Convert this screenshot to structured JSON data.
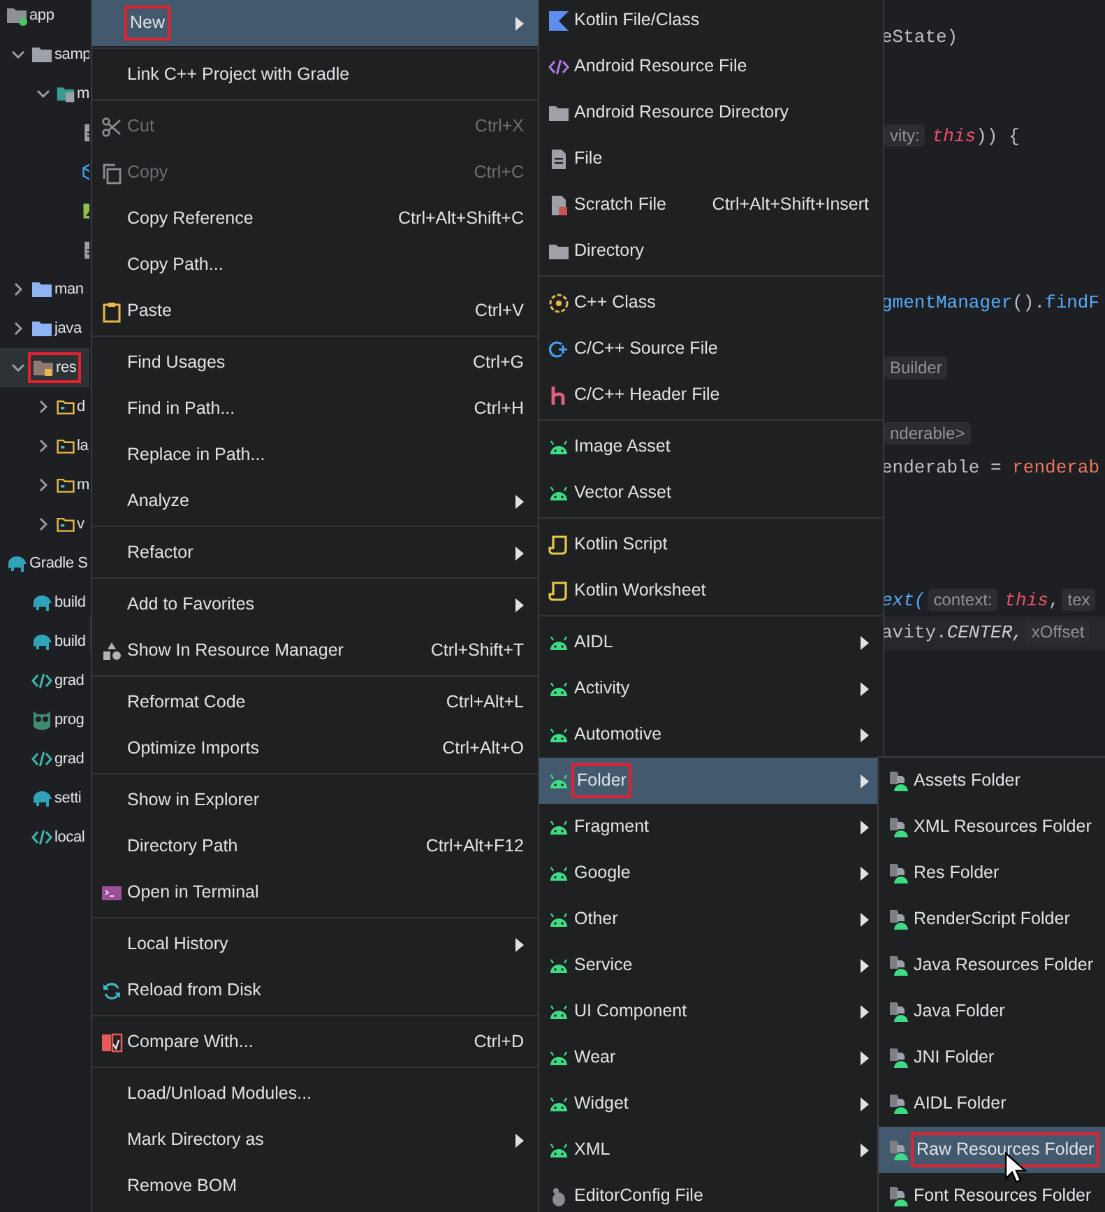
{
  "project_tree": [
    {
      "label": "app",
      "kind": "module",
      "selected": false,
      "annotated": false,
      "children": [
        {
          "label": "samp",
          "kind": "folder",
          "expanded": true,
          "selected": false,
          "annotated": false,
          "children": [
            {
              "label": "m",
              "kind": "source-set",
              "expanded": true,
              "selected": false,
              "annotated": false,
              "children": [
                {
                  "kind": "document",
                  "selected": false,
                  "annotated": false
                },
                {
                  "kind": "cube",
                  "selected": false,
                  "annotated": false
                },
                {
                  "kind": "image",
                  "selected": false,
                  "annotated": false
                },
                {
                  "kind": "document",
                  "selected": false,
                  "annotated": false
                }
              ]
            }
          ]
        },
        {
          "label": "man",
          "kind": "blue-folder",
          "expanded": false,
          "selected": false,
          "annotated": false
        },
        {
          "label": "java",
          "kind": "blue-folder",
          "expanded": false,
          "selected": false,
          "annotated": false
        },
        {
          "label": "res",
          "kind": "res-folder",
          "expanded": true,
          "selected": true,
          "annotated": true,
          "children": [
            {
              "label": "d",
              "kind": "res-dir",
              "expanded": false,
              "selected": false,
              "annotated": false
            },
            {
              "label": "la",
              "kind": "res-dir",
              "expanded": false,
              "selected": false,
              "annotated": false
            },
            {
              "label": "m",
              "kind": "res-dir",
              "expanded": false,
              "selected": false,
              "annotated": false
            },
            {
              "label": "v",
              "kind": "res-dir",
              "expanded": false,
              "selected": false,
              "annotated": false
            }
          ]
        }
      ]
    },
    {
      "label": "Gradle S",
      "kind": "gradle",
      "selected": false,
      "annotated": false,
      "children": [
        {
          "label": "build",
          "kind": "gradle",
          "selected": false,
          "annotated": false
        },
        {
          "label": "build",
          "kind": "gradle",
          "selected": false,
          "annotated": false
        },
        {
          "label": "grad",
          "kind": "xml",
          "selected": false,
          "annotated": false
        },
        {
          "label": "prog",
          "kind": "owl",
          "selected": false,
          "annotated": false
        },
        {
          "label": "grad",
          "kind": "xml",
          "selected": false,
          "annotated": false
        },
        {
          "label": "setti",
          "kind": "gradle",
          "selected": false,
          "annotated": false
        },
        {
          "label": "local",
          "kind": "xml",
          "selected": false,
          "annotated": false
        }
      ]
    }
  ],
  "editor": {
    "lines": [
      {
        "kind": "code",
        "current": false,
        "segments": [
          {
            "text": "eState)",
            "kind": "plain"
          }
        ]
      },
      {
        "kind": "blank"
      },
      {
        "kind": "blank"
      },
      {
        "kind": "code",
        "current": false,
        "segments": [
          {
            "text": "vity:",
            "kind": "hint"
          },
          {
            "text": "this",
            "kind": "keyword"
          },
          {
            "text": ")) {",
            "kind": "plain"
          }
        ]
      },
      {
        "kind": "blank"
      },
      {
        "kind": "blank"
      },
      {
        "kind": "blank"
      },
      {
        "kind": "blank"
      },
      {
        "kind": "code",
        "current": false,
        "segments": [
          {
            "text": "gmentManager",
            "kind": "method"
          },
          {
            "text": "().",
            "kind": "plain"
          },
          {
            "text": "findF",
            "kind": "method"
          }
        ]
      },
      {
        "kind": "blank"
      },
      {
        "kind": "code",
        "current": false,
        "segments": [
          {
            "text": "Builder",
            "kind": "hint"
          }
        ]
      },
      {
        "kind": "blank"
      },
      {
        "kind": "code",
        "current": false,
        "segments": [
          {
            "text": "nderable>",
            "kind": "hint"
          }
        ]
      },
      {
        "kind": "code",
        "current": false,
        "segments": [
          {
            "text": "enderable = ",
            "kind": "plain"
          },
          {
            "text": "renderab",
            "kind": "field"
          }
        ]
      },
      {
        "kind": "blank"
      },
      {
        "kind": "blank"
      },
      {
        "kind": "blank"
      },
      {
        "kind": "code",
        "current": false,
        "segments": [
          {
            "text": "ext(",
            "kind": "call"
          },
          {
            "text": "context:",
            "kind": "hint"
          },
          {
            "text": "this",
            "kind": "keyword"
          },
          {
            "text": ",",
            "kind": "plain"
          },
          {
            "text": "tex",
            "kind": "hint"
          }
        ]
      },
      {
        "kind": "code",
        "current": true,
        "segments": [
          {
            "text": "avity.",
            "kind": "plain"
          },
          {
            "text": "CENTER,",
            "kind": "constant"
          },
          {
            "text": "xOffset",
            "kind": "hint"
          }
        ]
      }
    ]
  },
  "context_menu": [
    {
      "kind": "plain",
      "label": "New",
      "submenu": true,
      "disabled": false,
      "selected": true,
      "annotated": true
    },
    {
      "kind": "separator"
    },
    {
      "kind": "plain",
      "label": "Link C++ Project with Gradle",
      "submenu": false,
      "disabled": false,
      "selected": false,
      "annotated": false
    },
    {
      "kind": "separator"
    },
    {
      "kind": "scissors",
      "label": "Cut",
      "shortcut": "Ctrl+X",
      "submenu": false,
      "disabled": true,
      "selected": false,
      "annotated": false
    },
    {
      "kind": "copy",
      "label": "Copy",
      "shortcut": "Ctrl+C",
      "submenu": false,
      "disabled": true,
      "selected": false,
      "annotated": false
    },
    {
      "kind": "plain",
      "label": "Copy Reference",
      "shortcut": "Ctrl+Alt+Shift+C",
      "submenu": false,
      "disabled": false,
      "selected": false,
      "annotated": false
    },
    {
      "kind": "plain",
      "label": "Copy Path...",
      "submenu": false,
      "disabled": false,
      "selected": false,
      "annotated": false
    },
    {
      "kind": "clipboard",
      "label": "Paste",
      "shortcut": "Ctrl+V",
      "submenu": false,
      "disabled": false,
      "selected": false,
      "annotated": false
    },
    {
      "kind": "separator"
    },
    {
      "kind": "plain",
      "label": "Find Usages",
      "shortcut": "Ctrl+G",
      "submenu": false,
      "disabled": false,
      "selected": false,
      "annotated": false
    },
    {
      "kind": "plain",
      "label": "Find in Path...",
      "shortcut": "Ctrl+H",
      "submenu": false,
      "disabled": false,
      "selected": false,
      "annotated": false
    },
    {
      "kind": "plain",
      "label": "Replace in Path...",
      "submenu": false,
      "disabled": false,
      "selected": false,
      "annotated": false
    },
    {
      "kind": "plain",
      "label": "Analyze",
      "submenu": true,
      "disabled": false,
      "selected": false,
      "annotated": false
    },
    {
      "kind": "separator"
    },
    {
      "kind": "plain",
      "label": "Refactor",
      "submenu": true,
      "disabled": false,
      "selected": false,
      "annotated": false
    },
    {
      "kind": "separator"
    },
    {
      "kind": "plain",
      "label": "Add to Favorites",
      "submenu": true,
      "disabled": false,
      "selected": false,
      "annotated": false
    },
    {
      "kind": "shapes",
      "label": "Show In Resource Manager",
      "shortcut": "Ctrl+Shift+T",
      "submenu": false,
      "disabled": false,
      "selected": false,
      "annotated": false
    },
    {
      "kind": "separator"
    },
    {
      "kind": "plain",
      "label": "Reformat Code",
      "shortcut": "Ctrl+Alt+L",
      "submenu": false,
      "disabled": false,
      "selected": false,
      "annotated": false
    },
    {
      "kind": "plain",
      "label": "Optimize Imports",
      "shortcut": "Ctrl+Alt+O",
      "submenu": false,
      "disabled": false,
      "selected": false,
      "annotated": false
    },
    {
      "kind": "separator"
    },
    {
      "kind": "plain",
      "label": "Show in Explorer",
      "submenu": false,
      "disabled": false,
      "selected": false,
      "annotated": false
    },
    {
      "kind": "plain",
      "label": "Directory Path",
      "shortcut": "Ctrl+Alt+F12",
      "submenu": false,
      "disabled": false,
      "selected": false,
      "annotated": false
    },
    {
      "kind": "terminal",
      "label": "Open in Terminal",
      "submenu": false,
      "disabled": false,
      "selected": false,
      "annotated": false
    },
    {
      "kind": "separator"
    },
    {
      "kind": "plain",
      "label": "Local History",
      "submenu": true,
      "disabled": false,
      "selected": false,
      "annotated": false
    },
    {
      "kind": "refresh",
      "label": "Reload from Disk",
      "submenu": false,
      "disabled": false,
      "selected": false,
      "annotated": false
    },
    {
      "kind": "separator"
    },
    {
      "kind": "compare",
      "label": "Compare With...",
      "shortcut": "Ctrl+D",
      "submenu": false,
      "disabled": false,
      "selected": false,
      "annotated": false
    },
    {
      "kind": "separator"
    },
    {
      "kind": "plain",
      "label": "Load/Unload Modules...",
      "submenu": false,
      "disabled": false,
      "selected": false,
      "annotated": false
    },
    {
      "kind": "plain",
      "label": "Mark Directory as",
      "submenu": true,
      "disabled": false,
      "selected": false,
      "annotated": false
    },
    {
      "kind": "plain",
      "label": "Remove BOM",
      "submenu": false,
      "disabled": false,
      "selected": false,
      "annotated": false
    }
  ],
  "new_submenu": [
    {
      "kind": "kotlin",
      "label": "Kotlin File/Class",
      "submenu": false,
      "selected": false,
      "annotated": false
    },
    {
      "kind": "code",
      "label": "Android Resource File",
      "submenu": false,
      "selected": false,
      "annotated": false
    },
    {
      "kind": "folder",
      "label": "Android Resource Directory",
      "submenu": false,
      "selected": false,
      "annotated": false
    },
    {
      "kind": "document",
      "label": "File",
      "submenu": false,
      "selected": false,
      "annotated": false
    },
    {
      "kind": "scratch",
      "label": "Scratch File",
      "shortcut": "Ctrl+Alt+Shift+Insert",
      "submenu": false,
      "selected": false,
      "annotated": false
    },
    {
      "kind": "folder",
      "label": "Directory",
      "submenu": false,
      "selected": false,
      "annotated": false
    },
    {
      "kind": "separator"
    },
    {
      "kind": "cpp-class",
      "label": "C++ Class",
      "submenu": false,
      "selected": false,
      "annotated": false
    },
    {
      "kind": "c-source",
      "label": "C/C++ Source File",
      "submenu": false,
      "selected": false,
      "annotated": false
    },
    {
      "kind": "c-header",
      "label": "C/C++ Header File",
      "submenu": false,
      "selected": false,
      "annotated": false
    },
    {
      "kind": "separator"
    },
    {
      "kind": "android",
      "label": "Image Asset",
      "submenu": false,
      "selected": false,
      "annotated": false
    },
    {
      "kind": "android",
      "label": "Vector Asset",
      "submenu": false,
      "selected": false,
      "annotated": false
    },
    {
      "kind": "separator"
    },
    {
      "kind": "script",
      "label": "Kotlin Script",
      "submenu": false,
      "selected": false,
      "annotated": false
    },
    {
      "kind": "script",
      "label": "Kotlin Worksheet",
      "submenu": false,
      "selected": false,
      "annotated": false
    },
    {
      "kind": "separator"
    },
    {
      "kind": "android",
      "label": "AIDL",
      "submenu": true,
      "selected": false,
      "annotated": false
    },
    {
      "kind": "android",
      "label": "Activity",
      "submenu": true,
      "selected": false,
      "annotated": false
    },
    {
      "kind": "android",
      "label": "Automotive",
      "submenu": true,
      "selected": false,
      "annotated": false
    },
    {
      "kind": "android",
      "label": "Folder",
      "submenu": true,
      "selected": true,
      "annotated": true
    },
    {
      "kind": "android",
      "label": "Fragment",
      "submenu": true,
      "selected": false,
      "annotated": false
    },
    {
      "kind": "android",
      "label": "Google",
      "submenu": true,
      "selected": false,
      "annotated": false
    },
    {
      "kind": "android",
      "label": "Other",
      "submenu": true,
      "selected": false,
      "annotated": false
    },
    {
      "kind": "android",
      "label": "Service",
      "submenu": true,
      "selected": false,
      "annotated": false
    },
    {
      "kind": "android",
      "label": "UI Component",
      "submenu": true,
      "selected": false,
      "annotated": false
    },
    {
      "kind": "android",
      "label": "Wear",
      "submenu": true,
      "selected": false,
      "annotated": false
    },
    {
      "kind": "android",
      "label": "Widget",
      "submenu": true,
      "selected": false,
      "annotated": false
    },
    {
      "kind": "android",
      "label": "XML",
      "submenu": true,
      "selected": false,
      "annotated": false
    },
    {
      "kind": "editorconfig",
      "label": "EditorConfig File",
      "submenu": false,
      "selected": false,
      "annotated": false
    }
  ],
  "folder_submenu": [
    {
      "kind": "folder-template",
      "label": "Assets Folder",
      "selected": false,
      "annotated": false
    },
    {
      "kind": "folder-template",
      "label": "XML Resources Folder",
      "selected": false,
      "annotated": false
    },
    {
      "kind": "folder-template",
      "label": "Res Folder",
      "selected": false,
      "annotated": false
    },
    {
      "kind": "folder-template",
      "label": "RenderScript Folder",
      "selected": false,
      "annotated": false
    },
    {
      "kind": "folder-template",
      "label": "Java Resources Folder",
      "selected": false,
      "annotated": false
    },
    {
      "kind": "folder-template",
      "label": "Java Folder",
      "selected": false,
      "annotated": false
    },
    {
      "kind": "folder-template",
      "label": "JNI Folder",
      "selected": false,
      "annotated": false
    },
    {
      "kind": "folder-template",
      "label": "AIDL Folder",
      "selected": false,
      "annotated": false
    },
    {
      "kind": "folder-template",
      "label": "Raw Resources Folder",
      "selected": true,
      "annotated": true
    },
    {
      "kind": "folder-template",
      "label": "Font Resources Folder",
      "selected": false,
      "annotated": false
    }
  ]
}
